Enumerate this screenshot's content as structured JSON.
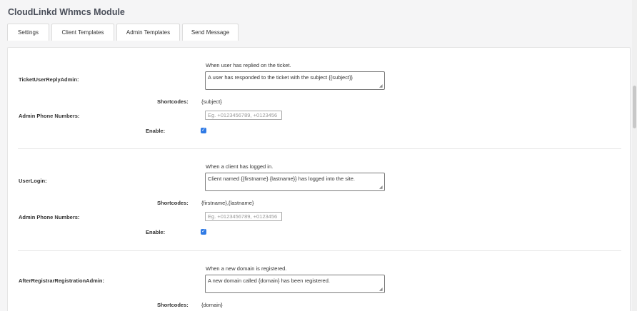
{
  "header": {
    "title": "CloudLinkd Whmcs Module"
  },
  "tabs": [
    {
      "label": "Settings"
    },
    {
      "label": "Client Templates"
    },
    {
      "label": "Admin Templates"
    },
    {
      "label": "Send Message"
    }
  ],
  "templates": [
    {
      "name": "TicketUserReplyAdmin:",
      "description": "When user has replied on the ticket.",
      "message": "A user has responded to the ticket with the subject {{subject}}",
      "shortcodes_label": "Shortcodes:",
      "shortcodes": "{subject}",
      "phone_label": "Admin Phone Numbers:",
      "phone_placeholder": "Eg. +0123456789, +0123456",
      "enable_label": "Enable:",
      "enabled": true
    },
    {
      "name": "UserLogin:",
      "description": "When a client has logged in.",
      "message": "Client named {{firstname} {lastname}} has logged into the site.",
      "shortcodes_label": "Shortcodes:",
      "shortcodes": "{firstname},{lastname}",
      "phone_label": "Admin Phone Numbers:",
      "phone_placeholder": "Eg. +0123456789, +0123456",
      "enable_label": "Enable:",
      "enabled": true
    },
    {
      "name": "AfterRegistrarRegistrationAdmin:",
      "description": "When a new domain is registered.",
      "message": "A new domain called {domain} has been registered.",
      "shortcodes_label": "Shortcodes:",
      "shortcodes": "{domain}"
    }
  ],
  "icons": {
    "checkbox": "check-icon",
    "resize": "resize-handle-icon"
  },
  "colors": {
    "accent": "#2f7ae5",
    "background": "#f5f5f6",
    "panel": "#ffffff"
  }
}
